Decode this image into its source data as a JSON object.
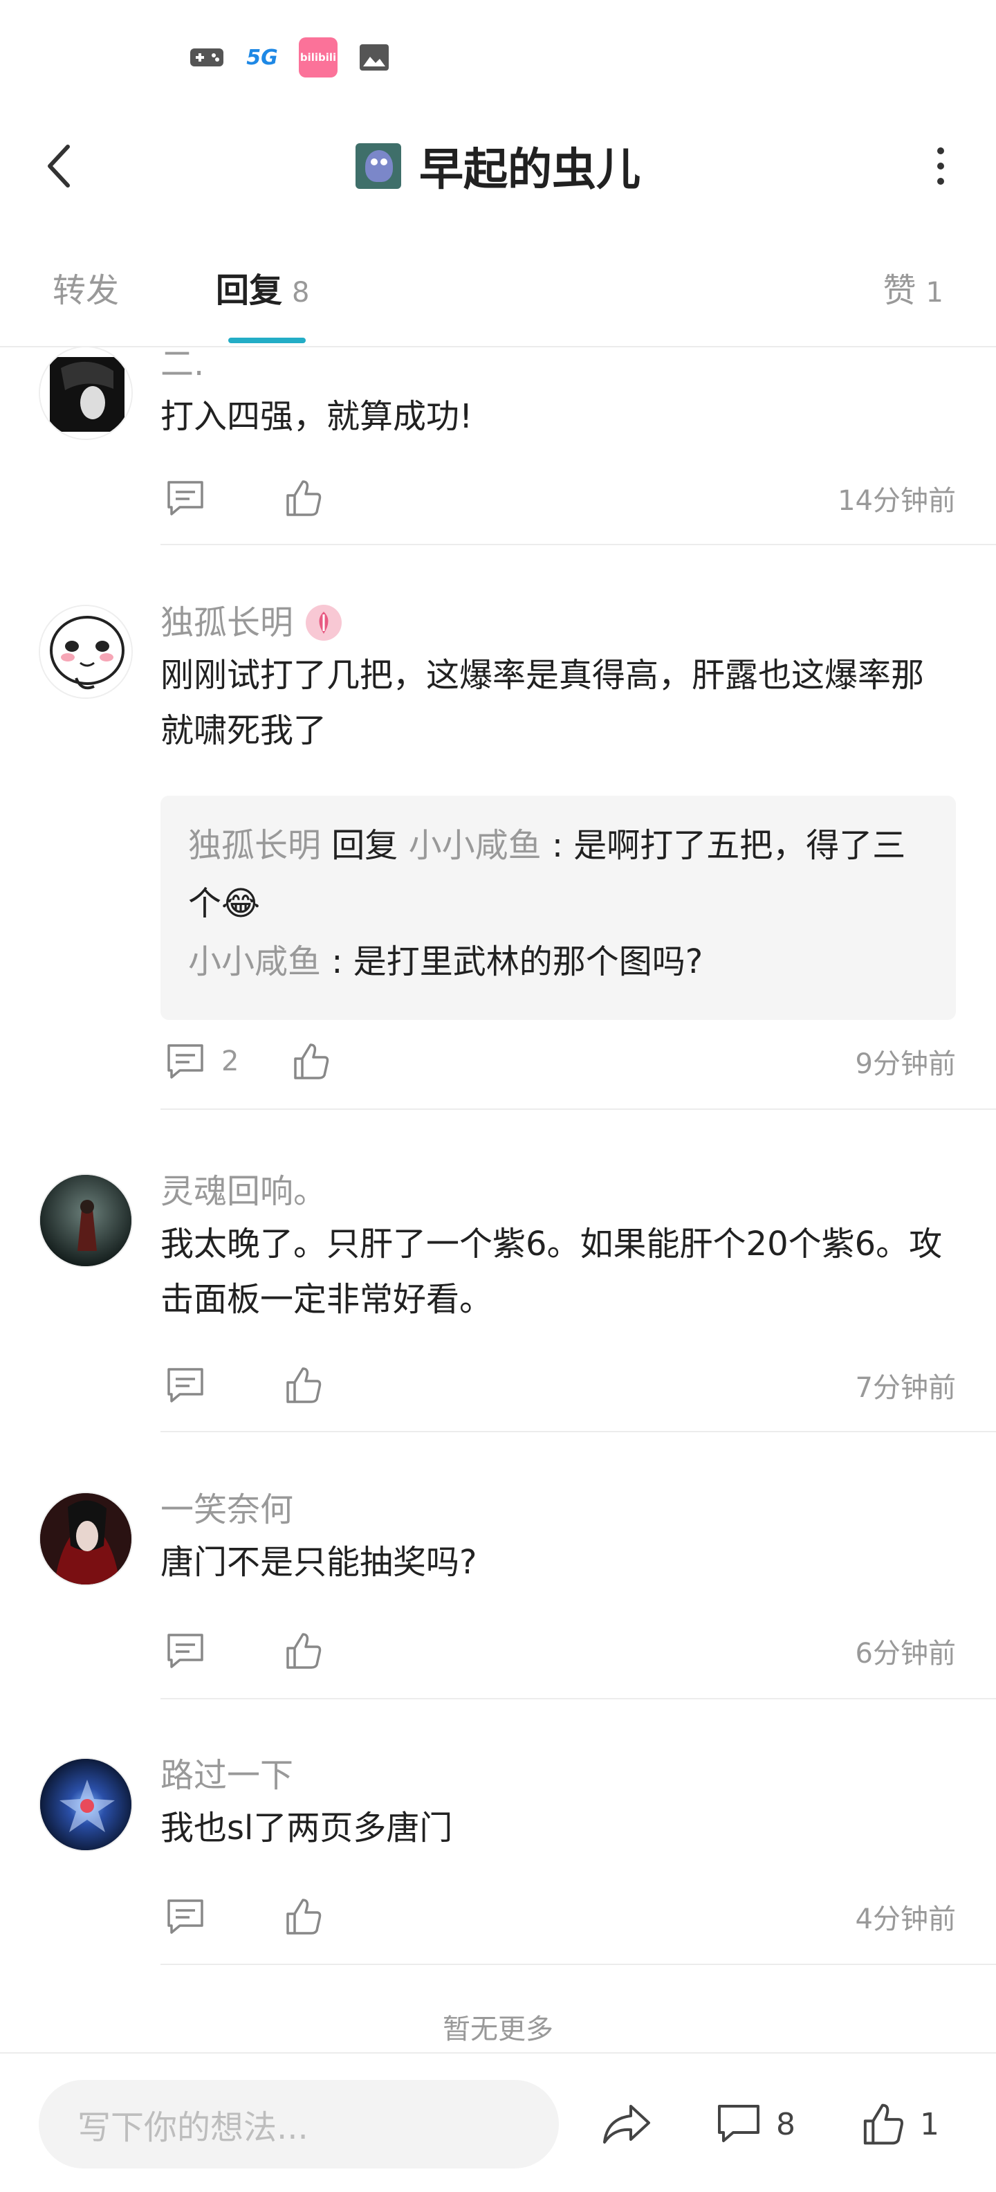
{
  "status_bar": {
    "icons": [
      "gamepad-icon",
      "5g-icon",
      "bilibili-icon",
      "image-icon"
    ],
    "bili_label": "bilibili",
    "five_g_label": "5G"
  },
  "header": {
    "title": "早起的虫儿"
  },
  "tabs": [
    {
      "label": "转发",
      "count": ""
    },
    {
      "label": "回复",
      "count": "8"
    },
    {
      "label": "赞",
      "count": "1"
    }
  ],
  "accent_color": "#23adc6",
  "comments": [
    {
      "name": "二.",
      "text": "打入四强，就算成功!",
      "reply_count": "",
      "time": "14分钟前"
    },
    {
      "name": "独孤长明",
      "text": "刚刚试打了几把，这爆率是真得高，肝露也这爆率那就啸死我了",
      "reply_count": "2",
      "time": "9分钟前",
      "replies": [
        {
          "author": "独孤长明",
          "reply_word": "回复",
          "target": "小小咸鱼",
          "sep": ":",
          "text": "是啊打了五把，得了三个😂"
        },
        {
          "author": "小小咸鱼",
          "sep": ":",
          "text": "是打里武林的那个图吗?"
        }
      ]
    },
    {
      "name": "灵魂回响。",
      "text": "我太晚了。只肝了一个紫6。如果能肝个20个紫6。攻击面板一定非常好看。",
      "reply_count": "",
      "time": "7分钟前"
    },
    {
      "name": "一笑奈何",
      "text": "唐门不是只能抽奖吗?",
      "reply_count": "",
      "time": "6分钟前"
    },
    {
      "name": "路过一下",
      "text": "我也sl了两页多唐门",
      "reply_count": "",
      "time": "4分钟前"
    }
  ],
  "footer_note": "暂无更多",
  "bottom_bar": {
    "input_placeholder": "写下你的想法...",
    "comment_count": "8",
    "like_count": "1"
  }
}
